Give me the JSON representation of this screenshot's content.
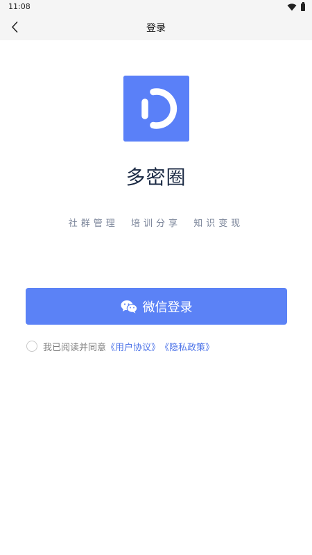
{
  "status_bar": {
    "time": "11:08",
    "icons": [
      "wifi-icon",
      "battery-icon"
    ]
  },
  "nav_bar": {
    "back_icon": "chevron-left-icon",
    "title": "登录"
  },
  "app": {
    "logo_icon": "app-logo-icon",
    "name": "多密圈",
    "tagline": "社群管理  培训分享  知识变现"
  },
  "login": {
    "wechat_button_label": "微信登录",
    "wechat_icon": "wechat-icon"
  },
  "agreement": {
    "checked": false,
    "prefix_text": "我已阅读并同意",
    "user_agreement_link": "《用户协议》",
    "privacy_policy_link": "《隐私政策》"
  },
  "colors": {
    "primary": "#5b82f6",
    "link": "#4c73e8",
    "title_text": "#1b2a44",
    "tagline_text": "#7a8499",
    "nav_background": "#f5f5f5"
  }
}
